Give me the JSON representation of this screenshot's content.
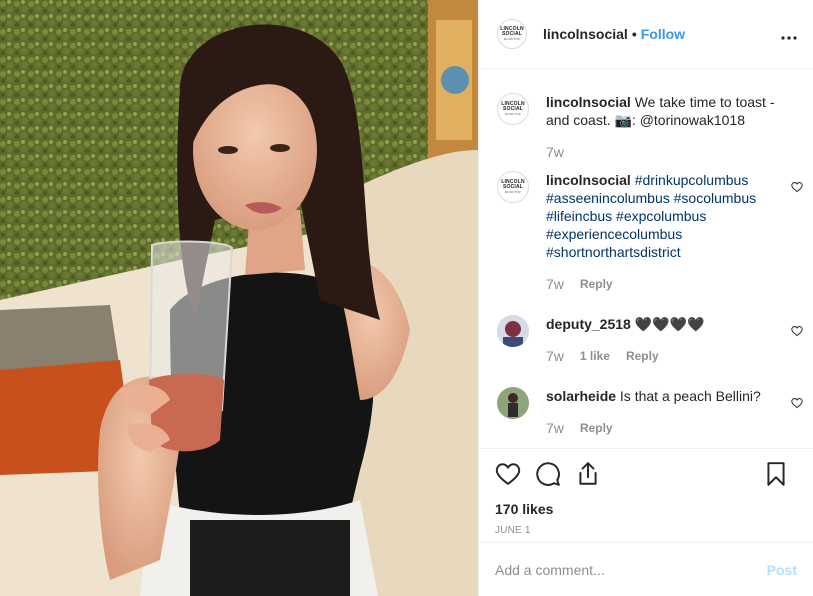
{
  "header": {
    "username": "lincolnsocial",
    "separator": "•",
    "follow_label": "Follow",
    "more_label": "•••",
    "logo_text": [
      "LINCOLN",
      "SOCIAL",
      "ROOFTOP"
    ]
  },
  "caption": {
    "username": "lincolnsocial",
    "text": "We take time to toast - and coast. 📷: @torinowak1018",
    "time": "7w"
  },
  "comments": [
    {
      "username": "lincolnsocial",
      "text": "#drinkupcolumbus #asseenincolumbus #socolumbus #lifeincbus #expcolumbus #experiencecolumbus #shortnorthartsdistrict",
      "time": "7w",
      "reply_label": "Reply"
    },
    {
      "username": "deputy_2518",
      "text": "🖤🖤🖤🖤",
      "time": "7w",
      "likes_label": "1 like",
      "reply_label": "Reply"
    },
    {
      "username": "solarheide",
      "text": "Is that a peach Bellini?",
      "time": "7w",
      "reply_label": "Reply"
    }
  ],
  "post": {
    "likes": "170 likes",
    "date": "JUNE 1"
  },
  "add_comment": {
    "placeholder": "Add a comment...",
    "post_label": "Post"
  },
  "colors": {
    "link_blue": "#3897f0",
    "hashtag": "#003569",
    "muted": "#8e8e8e",
    "post_disabled": "#b2dffc"
  },
  "icons": [
    "heart-icon",
    "comment-icon",
    "share-icon",
    "bookmark-icon",
    "more-icon"
  ]
}
